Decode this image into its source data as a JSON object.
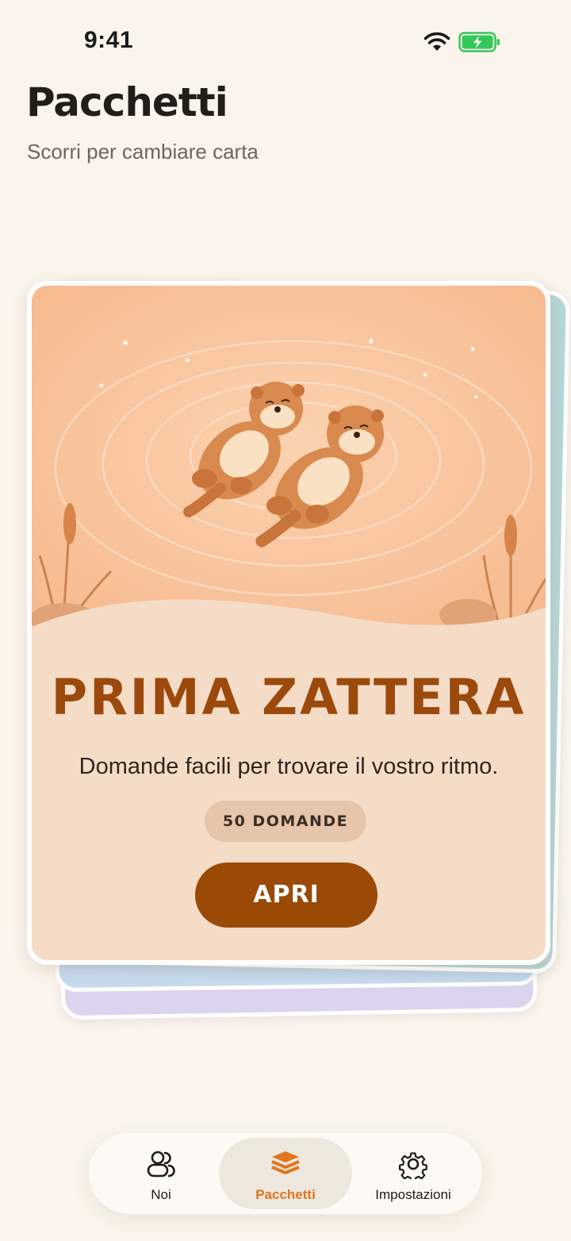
{
  "status_bar": {
    "time": "9:41"
  },
  "header": {
    "title": "Pacchetti",
    "subtitle": "Scorri per cambiare carta"
  },
  "deck": {
    "title": "PRIMA ZATTERA",
    "description": "Domande facili per trovare il vostro ritmo.",
    "count_label": "50 DOMANDE",
    "open_label": "APRI"
  },
  "tab_bar": {
    "items": [
      {
        "label": "Noi",
        "icon": "people-icon"
      },
      {
        "label": "Pacchetti",
        "icon": "stack-icon"
      },
      {
        "label": "Impostazioni",
        "icon": "gear-icon"
      }
    ],
    "active": "Pacchetti"
  },
  "colors": {
    "background": "#faf4ec",
    "card": "#f5dcc7",
    "accent_brown": "#9a4906",
    "tab_active": "#e0761f",
    "battery": "#34c759"
  }
}
